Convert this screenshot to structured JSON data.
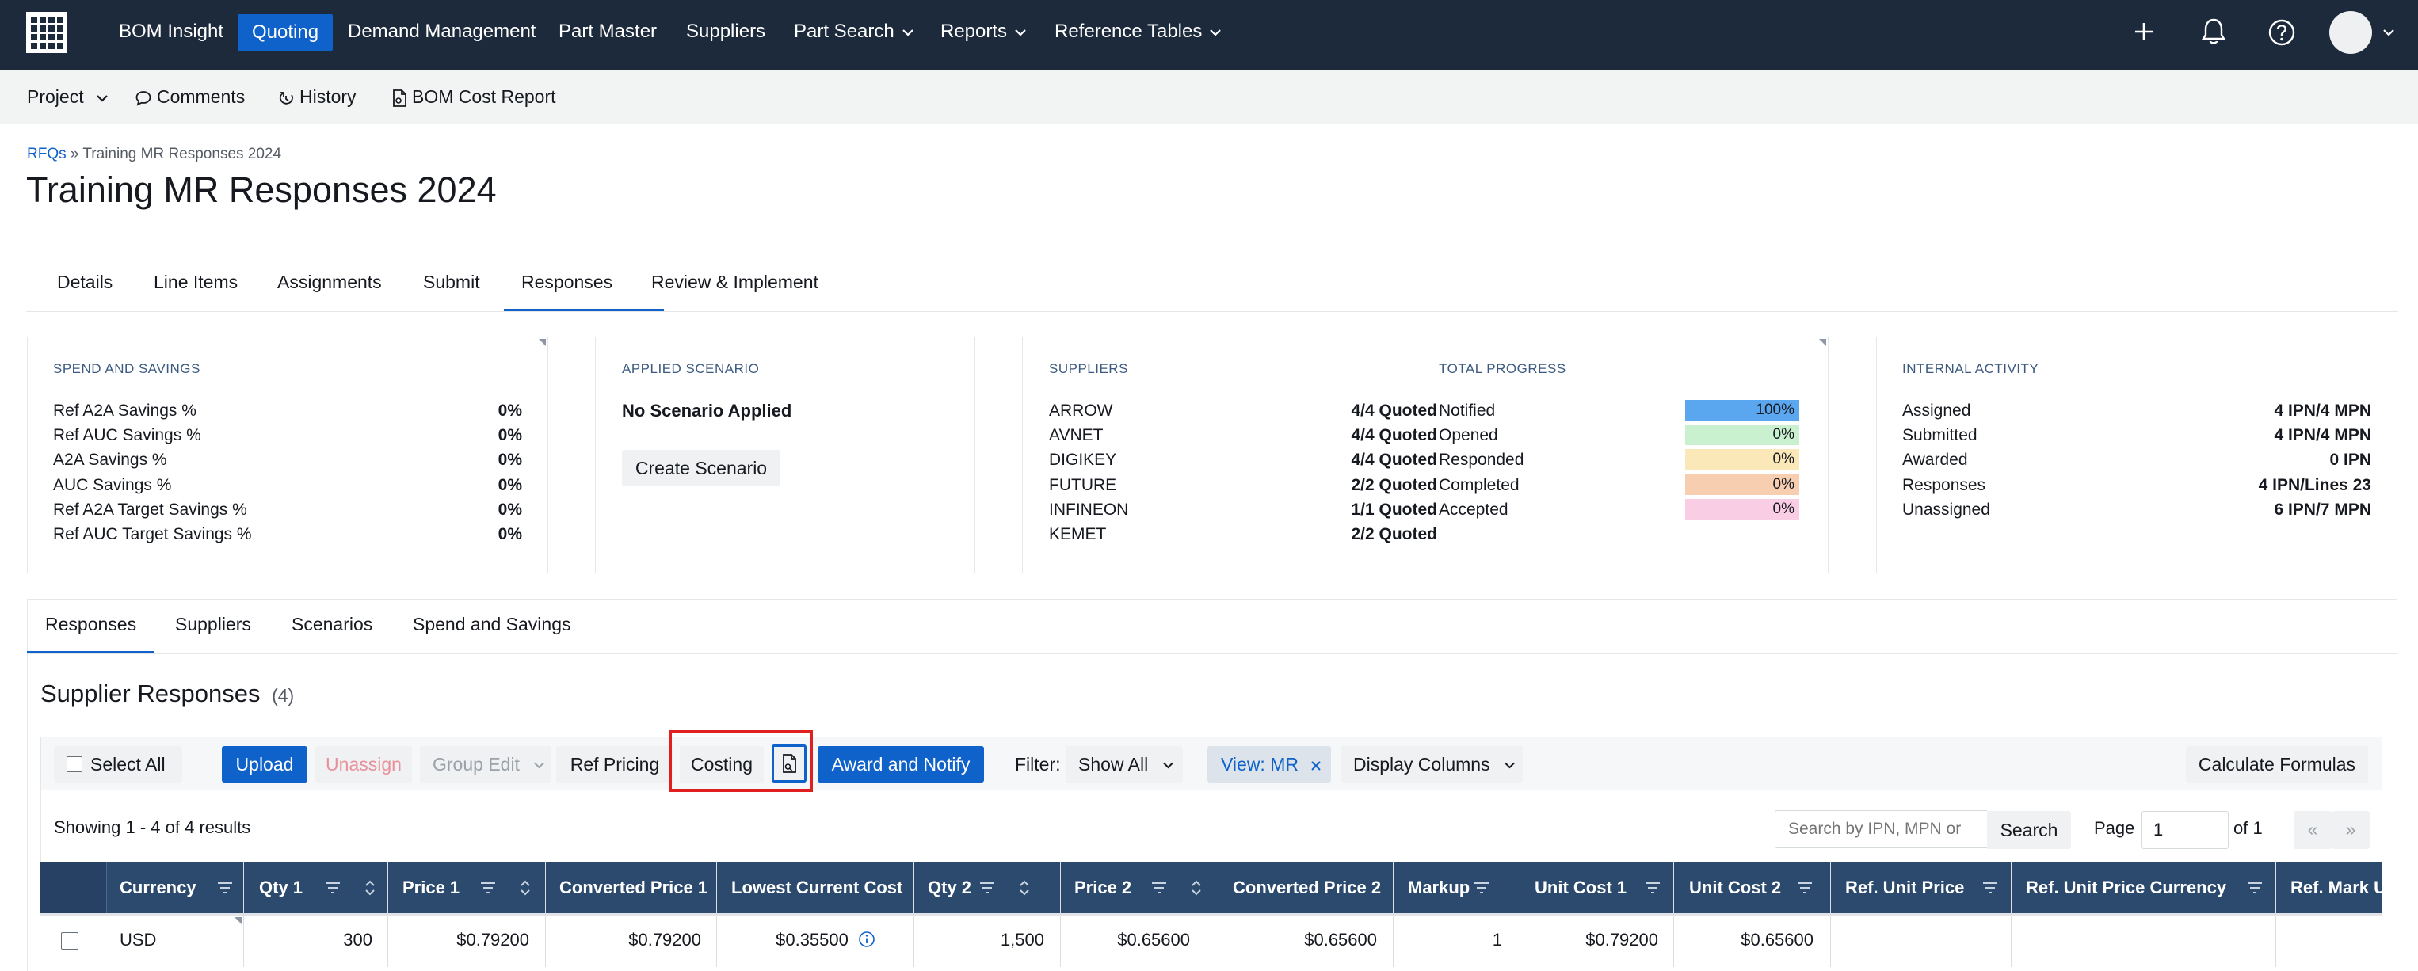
{
  "nav": {
    "items": [
      "BOM Insight",
      "Quoting",
      "Demand Management",
      "Part Master",
      "Suppliers",
      "Part Search",
      "Reports",
      "Reference Tables"
    ]
  },
  "subnav": {
    "project": "Project",
    "comments": "Comments",
    "history": "History",
    "bom_cost_report": "BOM Cost Report"
  },
  "breadcrumb": {
    "root": "RFQs",
    "sep": "»",
    "current": "Training MR Responses 2024"
  },
  "page_title": "Training MR Responses 2024",
  "tabs": [
    "Details",
    "Line Items",
    "Assignments",
    "Submit",
    "Responses",
    "Review & Implement"
  ],
  "spend": {
    "title": "SPEND AND SAVINGS",
    "rows": [
      {
        "label": "Ref A2A Savings %",
        "value": "0%"
      },
      {
        "label": "Ref AUC Savings %",
        "value": "0%"
      },
      {
        "label": "A2A Savings %",
        "value": "0%"
      },
      {
        "label": "AUC Savings %",
        "value": "0%"
      },
      {
        "label": "Ref A2A Target Savings %",
        "value": "0%"
      },
      {
        "label": "Ref AUC Target Savings %",
        "value": "0%"
      }
    ]
  },
  "scenario": {
    "title": "APPLIED SCENARIO",
    "status": "No Scenario Applied",
    "button": "Create Scenario"
  },
  "suppliers": {
    "title": "SUPPLIERS",
    "rows": [
      {
        "label": "ARROW",
        "value": "4/4 Quoted"
      },
      {
        "label": "AVNET",
        "value": "4/4 Quoted"
      },
      {
        "label": "DIGIKEY",
        "value": "4/4 Quoted"
      },
      {
        "label": "FUTURE",
        "value": "2/2 Quoted"
      },
      {
        "label": "INFINEON",
        "value": "1/1 Quoted"
      },
      {
        "label": "KEMET",
        "value": "2/2 Quoted"
      }
    ]
  },
  "progress": {
    "title": "TOTAL PROGRESS",
    "rows": [
      {
        "label": "Notified",
        "value": "100%",
        "fraction": 1.0,
        "color": "#5aa7f0"
      },
      {
        "label": "Opened",
        "value": "0%",
        "fraction": 0,
        "color": "#c9f0cf"
      },
      {
        "label": "Responded",
        "value": "0%",
        "fraction": 0,
        "color": "#fbe8b8"
      },
      {
        "label": "Completed",
        "value": "0%",
        "fraction": 0,
        "color": "#f8ceb0"
      },
      {
        "label": "Accepted",
        "value": "0%",
        "fraction": 0,
        "color": "#f9cde3"
      }
    ]
  },
  "internal": {
    "title": "INTERNAL ACTIVITY",
    "rows": [
      {
        "label": "Assigned",
        "value": "4 IPN/4 MPN"
      },
      {
        "label": "Submitted",
        "value": "4 IPN/4 MPN"
      },
      {
        "label": "Awarded",
        "value": "0 IPN"
      },
      {
        "label": "Responses",
        "value": "4 IPN/Lines 23"
      },
      {
        "label": "Unassigned",
        "value": "6 IPN/7 MPN"
      }
    ]
  },
  "subtabs": [
    "Responses",
    "Suppliers",
    "Scenarios",
    "Spend and Savings"
  ],
  "section": {
    "title": "Supplier Responses",
    "count": "(4)"
  },
  "toolbar": {
    "select_all": "Select All",
    "upload": "Upload",
    "unassign": "Unassign",
    "group_edit": "Group Edit",
    "ref_pricing": "Ref Pricing",
    "costing": "Costing",
    "award_notify": "Award and Notify",
    "filter_label": "Filter:",
    "filter_value": "Show All",
    "view_tag": "View: MR",
    "display_columns": "Display Columns",
    "calculate": "Calculate Formulas"
  },
  "results": {
    "showing": "Showing 1 - 4 of 4 results",
    "search_placeholder": "Search by IPN, MPN or",
    "search_button": "Search",
    "page_label": "Page",
    "page_value": "1",
    "page_of": "of 1",
    "first": "«",
    "last": "»"
  },
  "table": {
    "headers": [
      "Currency",
      "Qty 1",
      "Price 1",
      "Converted Price 1",
      "Lowest Current Cost",
      "Qty 2",
      "Price 2",
      "Converted Price 2",
      "Markup",
      "Unit Cost 1",
      "Unit Cost 2",
      "Ref. Unit Price",
      "Ref. Unit Price Currency",
      "Ref. Mark U"
    ],
    "row": [
      "USD",
      "300",
      "$0.79200",
      "$0.79200",
      "$0.35500",
      "1,500",
      "$0.65600",
      "$0.65600",
      "1",
      "$0.79200",
      "$0.65600",
      "",
      "",
      ""
    ]
  },
  "colors": {
    "nav_bg": "#1d2a3b",
    "accent": "#0f62c9",
    "header_bg": "#2c4a6e",
    "highlight": "#e02020"
  }
}
